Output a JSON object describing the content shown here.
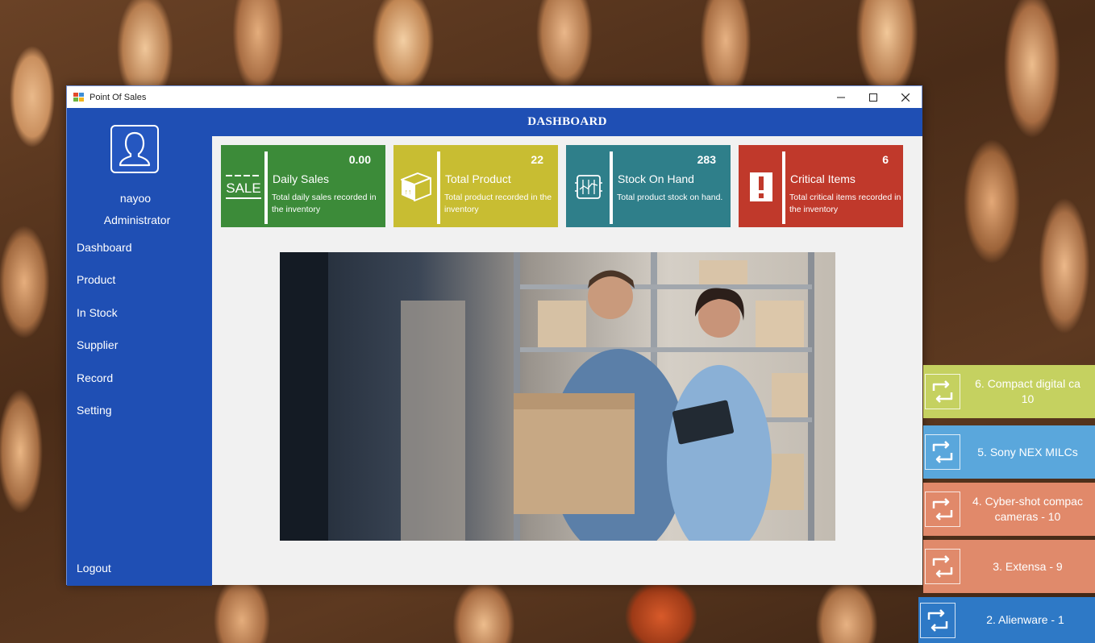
{
  "window": {
    "title": "Point Of Sales",
    "controls": {
      "minimize": "—",
      "maximize": "☐",
      "close": "✕"
    }
  },
  "sidebar": {
    "user_name": "nayoo",
    "user_role": "Administrator",
    "nav": [
      "Dashboard",
      "Product",
      "In Stock",
      "Supplier",
      "Record",
      "Setting"
    ],
    "logout": "Logout"
  },
  "header": {
    "title": "DASHBOARD"
  },
  "cards": {
    "daily_sales": {
      "value": "0.00",
      "label": "Daily Sales",
      "desc": "Total daily sales recorded in the inventory",
      "icon": "sale-tag-icon",
      "icon_text": "SALE",
      "color": "#3c8b39"
    },
    "total_product": {
      "value": "22",
      "label": "Total Product",
      "desc": "Total product recorded in the inventory",
      "icon": "box-icon",
      "color": "#c8bd32"
    },
    "stock_on_hand": {
      "value": "283",
      "label": "Stock On Hand",
      "desc": "Total product stock on hand.",
      "icon": "stock-chart-icon",
      "color": "#2f7f8a"
    },
    "critical_items": {
      "value": "6",
      "label": "Critical Items",
      "desc": "Total critical items recorded in the inventory",
      "icon": "warning-icon",
      "color": "#c0392b"
    }
  },
  "notifications": [
    {
      "text": "6. Compact digital ca",
      "subtext": "10",
      "icon": "repeat-icon",
      "color": "#c5d160"
    },
    {
      "text": "5. Sony NEX MILCs",
      "icon": "repeat-icon",
      "color": "#5aa7dc"
    },
    {
      "text": "4. Cyber-shot compac",
      "subtext": "cameras - 10",
      "icon": "repeat-icon",
      "color": "#e1896a"
    },
    {
      "text": "3. Extensa - 9",
      "icon": "repeat-icon",
      "color": "#e08a6b"
    },
    {
      "text": "2. Alienware - 1",
      "icon": "repeat-icon",
      "color": "#2e79c6"
    }
  ]
}
